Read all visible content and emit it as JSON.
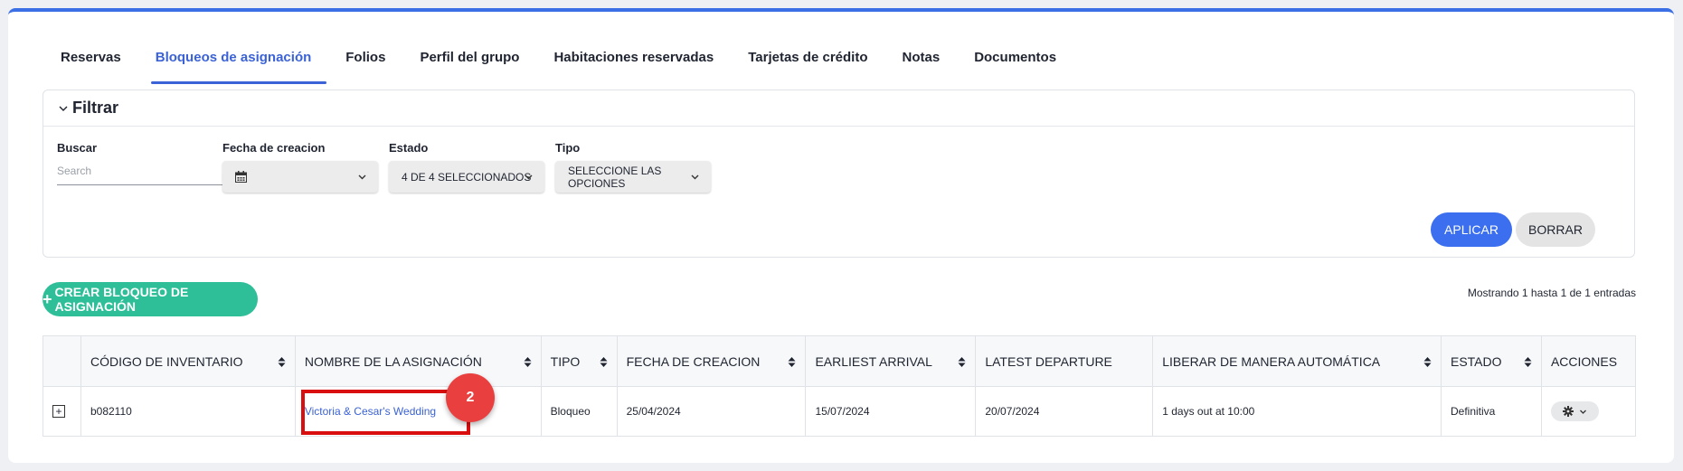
{
  "tabs": [
    {
      "label": "Reservas"
    },
    {
      "label": "Bloqueos de asignación"
    },
    {
      "label": "Folios"
    },
    {
      "label": "Perfil del grupo"
    },
    {
      "label": "Habitaciones reservadas"
    },
    {
      "label": "Tarjetas de crédito"
    },
    {
      "label": "Notas"
    },
    {
      "label": "Documentos"
    }
  ],
  "filter": {
    "title": "Filtrar",
    "search_label": "Buscar",
    "search_placeholder": "Search",
    "date_label": "Fecha de creacion",
    "status_label": "Estado",
    "status_value": "4 DE 4 SELECCIONADOS",
    "type_label": "Tipo",
    "type_value": "SELECCIONE LAS OPCIONES",
    "apply": "APLICAR",
    "clear": "BORRAR"
  },
  "create_button": "CREAR BLOQUEO DE ASIGNACIÓN",
  "showing": "Mostrando 1 hasta 1 de 1 entradas",
  "table": {
    "headers": [
      "CÓDIGO DE INVENTARIO",
      "NOMBRE DE LA ASIGNACIÓN",
      "TIPO",
      "FECHA DE CREACION",
      "EARLIEST ARRIVAL",
      "LATEST DEPARTURE",
      "LIBERAR DE MANERA AUTOMÁTICA",
      "ESTADO",
      "ACCIONES"
    ],
    "rows": [
      {
        "code": "b082110",
        "name": "Victoria & Cesar's Wedding",
        "type": "Bloqueo",
        "created": "25/04/2024",
        "arrival": "15/07/2024",
        "departure": "20/07/2024",
        "release": "1 days out at 10:00",
        "status": "Definitiva"
      }
    ]
  },
  "annotation": {
    "step": "2",
    "color": "#e9403f",
    "highlight_color": "#d90f0f"
  },
  "colors": {
    "accent": "#3b62d6",
    "apply": "#3b6ff0",
    "create": "#2ebf98"
  }
}
